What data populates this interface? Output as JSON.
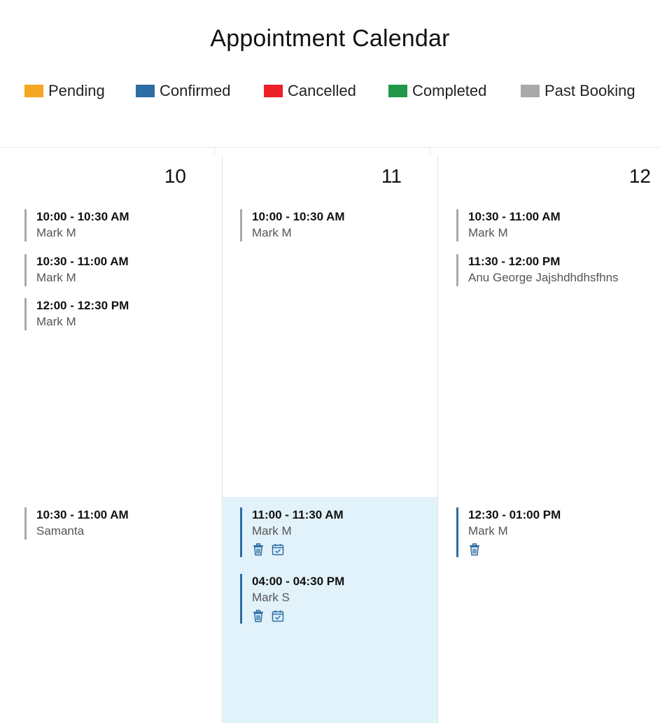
{
  "title": "Appointment Calendar",
  "legend": [
    {
      "label": "Pending",
      "color": "#f5a623"
    },
    {
      "label": "Confirmed",
      "color": "#2c6da3"
    },
    {
      "label": "Cancelled",
      "color": "#ee2028"
    },
    {
      "label": "Completed",
      "color": "#21974a"
    },
    {
      "label": "Past Booking",
      "color": "#a9a9a9"
    }
  ],
  "days": [
    {
      "number": "10",
      "appointments": [
        {
          "time": "10:00 - 10:30 AM",
          "name": "Mark M",
          "status": "past"
        },
        {
          "time": "10:30 - 11:00 AM",
          "name": "Mark M",
          "status": "past"
        },
        {
          "time": "12:00 - 12:30 PM",
          "name": "Mark M",
          "status": "past"
        },
        {
          "time": "10:30 - 11:00 AM",
          "name": "Samanta",
          "status": "past"
        }
      ]
    },
    {
      "number": "11",
      "appointments": [
        {
          "time": "10:00 - 10:30 AM",
          "name": "Mark M",
          "status": "past"
        },
        {
          "time": "11:00 - 11:30 AM",
          "name": "Mark M",
          "status": "confirmed",
          "actions": [
            "trash-icon",
            "calendar-check-icon"
          ]
        },
        {
          "time": "04:00 - 04:30 PM",
          "name": "Mark S",
          "status": "confirmed",
          "actions": [
            "trash-icon",
            "calendar-check-icon"
          ]
        }
      ]
    },
    {
      "number": "12",
      "appointments": [
        {
          "time": "10:30 - 11:00 AM",
          "name": "Mark M",
          "status": "past"
        },
        {
          "time": "11:30 - 12:00 PM",
          "name": "Anu George Jajshdhdhsfhns",
          "status": "past"
        },
        {
          "time": "12:30 - 01:00 PM",
          "name": "Mark M",
          "status": "confirmed",
          "actions": [
            "trash-icon"
          ]
        }
      ]
    }
  ]
}
